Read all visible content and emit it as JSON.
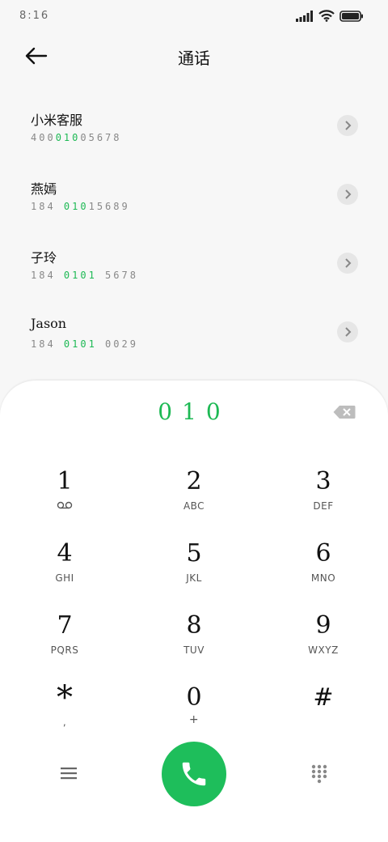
{
  "status": {
    "time": "8:16"
  },
  "header": {
    "title": "通话"
  },
  "contacts": [
    {
      "name": "小米客服",
      "num_pre": "400",
      "num_hl": "010",
      "num_post": "05678"
    },
    {
      "name": "燕嫣",
      "num_pre": "184 ",
      "num_hl": "010",
      "num_post": "15689"
    },
    {
      "name": "子玲",
      "num_pre": "184 ",
      "num_hl": "0101",
      "num_post": " 5678"
    },
    {
      "name": "Jason",
      "num_pre": "184 ",
      "num_hl": "0101",
      "num_post": " 0029"
    }
  ],
  "dialer": {
    "input": "010",
    "keys": [
      {
        "digit": "1",
        "letters": ""
      },
      {
        "digit": "2",
        "letters": "ABC"
      },
      {
        "digit": "3",
        "letters": "DEF"
      },
      {
        "digit": "4",
        "letters": "GHI"
      },
      {
        "digit": "5",
        "letters": "JKL"
      },
      {
        "digit": "6",
        "letters": "MNO"
      },
      {
        "digit": "7",
        "letters": "PQRS"
      },
      {
        "digit": "8",
        "letters": "TUV"
      },
      {
        "digit": "9",
        "letters": "WXYZ"
      },
      {
        "digit": "*",
        "letters": ","
      },
      {
        "digit": "0",
        "letters": "+"
      },
      {
        "digit": "#",
        "letters": ""
      }
    ]
  },
  "colors": {
    "accent": "#1db954",
    "call": "#1ebe5b"
  },
  "icons": [
    "back-arrow-icon",
    "signal-icon",
    "wifi-icon",
    "battery-icon",
    "chevron-right-icon",
    "backspace-icon",
    "voicemail-icon",
    "menu-icon",
    "phone-icon",
    "dialpad-icon"
  ]
}
